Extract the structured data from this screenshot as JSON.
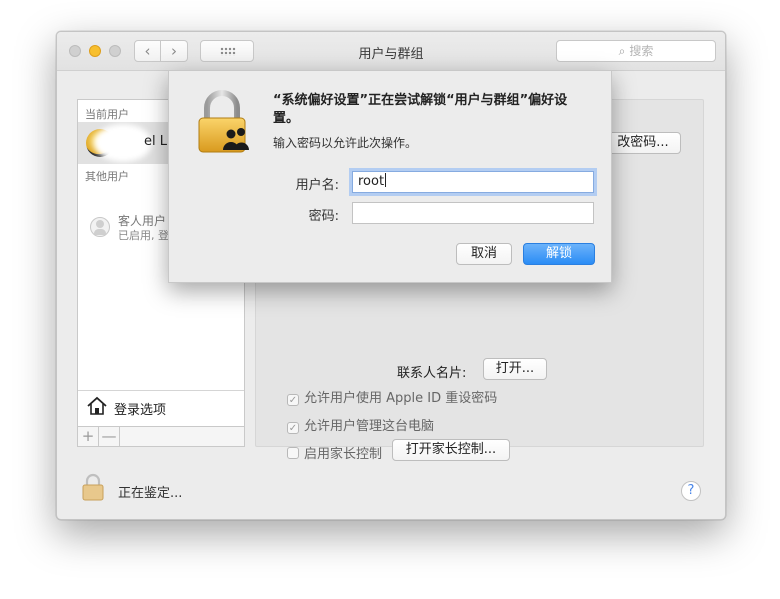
{
  "window": {
    "title": "用户与群组",
    "search_placeholder": "搜索"
  },
  "sidebar": {
    "current_users_heading": "当前用户",
    "current_user_name": "el L",
    "other_users_heading": "其他用户",
    "guest_name": "客人用户",
    "guest_status": "已启用, 登",
    "login_options_label": "登录选项",
    "add_label": "+",
    "remove_label": "—"
  },
  "panel": {
    "change_password_label": "改密码...",
    "contact_card_label": "联系人名片:",
    "open_button_label": "打开...",
    "options": [
      {
        "label": "允许用户使用 Apple ID 重设密码",
        "checked": true
      },
      {
        "label": "允许用户管理这台电脑",
        "checked": true
      },
      {
        "label": "启用家长控制",
        "checked": false
      }
    ],
    "parental_button_label": "打开家长控制..."
  },
  "footer": {
    "status_text": "正在鉴定...",
    "help_label": "?"
  },
  "dialog": {
    "title": "“系统偏好设置”正在尝试解锁“用户与群组”偏好设置。",
    "info": "输入密码以允许此次操作。",
    "username_label": "用户名:",
    "username_value": "root",
    "password_label": "密码:",
    "password_value": "",
    "cancel_label": "取消",
    "unlock_label": "解锁"
  },
  "colors": {
    "accent": "#2a8cf5",
    "minimize": "#f7bf2e"
  }
}
